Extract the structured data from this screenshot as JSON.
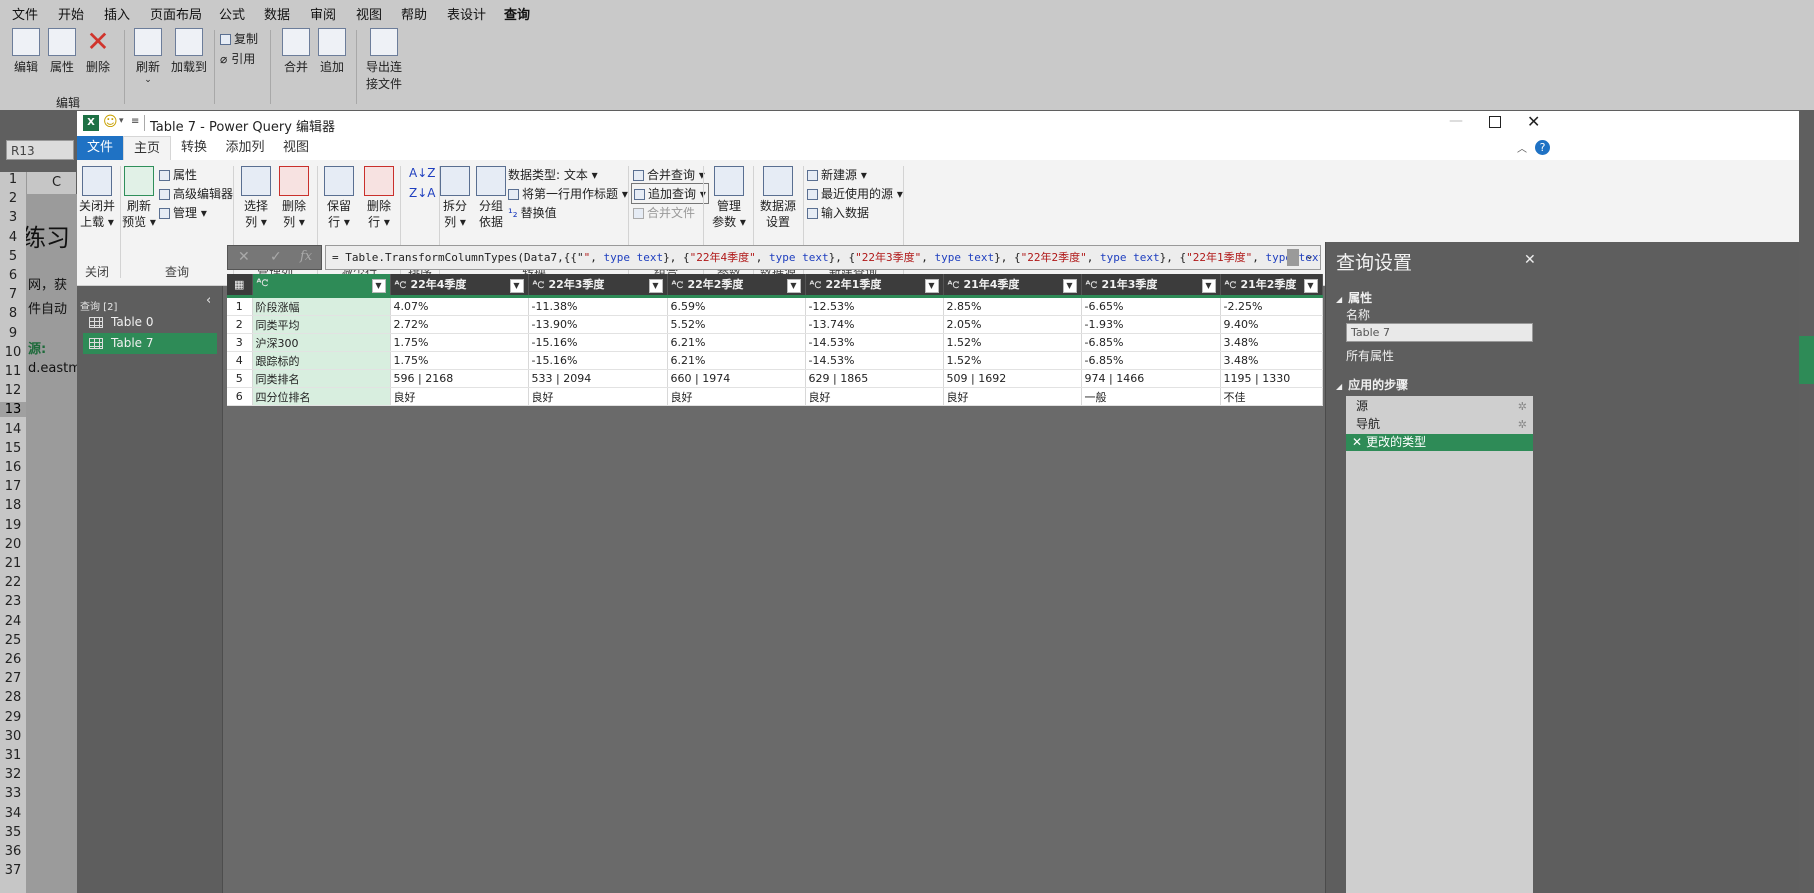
{
  "excel": {
    "menu": [
      "文件",
      "开始",
      "插入",
      "页面布局",
      "公式",
      "数据",
      "审阅",
      "视图",
      "帮助",
      "表设计",
      "查询"
    ],
    "ribbon": {
      "edit": "编辑",
      "properties": "属性",
      "delete": "删除",
      "refresh": "刷新",
      "load_to": "加载到",
      "copy": "复制",
      "reference": "引用",
      "merge": "合并",
      "append": "追加",
      "export_line1": "导出连",
      "export_line2": "接文件",
      "group_label": "编辑"
    },
    "name_box": "R13",
    "col_header": "C",
    "rows": [
      "1",
      "2",
      "3",
      "4",
      "5",
      "6",
      "7",
      "8",
      "9",
      "10",
      "11",
      "12",
      "13",
      "14",
      "15",
      "16",
      "17",
      "18",
      "19",
      "20",
      "21",
      "22",
      "23",
      "24",
      "25",
      "26",
      "27",
      "28",
      "29",
      "30",
      "31",
      "32",
      "33",
      "34",
      "35",
      "36",
      "37"
    ],
    "sheet_text": {
      "title": "练习",
      "line1": "网，获",
      "line2": "件自动",
      "source": "源:",
      "url": "d.eastm"
    }
  },
  "pq": {
    "window_title": "Table 7 - Power Query 编辑器",
    "tabs": [
      "文件",
      "主页",
      "转换",
      "添加列",
      "视图"
    ],
    "ribbon": {
      "close_load_1": "关闭并",
      "close_load_2": "上载",
      "refresh_1": "刷新",
      "refresh_2": "预览",
      "properties": "属性",
      "advanced_editor": "高级编辑器",
      "manage": "管理",
      "choose_cols_1": "选择",
      "choose_cols_2": "列",
      "remove_cols_1": "删除",
      "remove_cols_2": "列",
      "keep_rows_1": "保留",
      "keep_rows_2": "行",
      "remove_rows_1": "删除",
      "remove_rows_2": "行",
      "split_1": "拆分",
      "split_2": "列",
      "group_1": "分组",
      "group_2": "依据",
      "data_type": "数据类型: 文本",
      "first_row_header": "将第一行用作标题",
      "replace_values": "替换值",
      "merge_queries": "合并查询",
      "append_queries": "追加查询",
      "combine_files": "合并文件",
      "manage_params_1": "管理",
      "manage_params_2": "参数",
      "ds_settings_1": "数据源",
      "ds_settings_2": "设置",
      "new_source": "新建源",
      "recent_sources": "最近使用的源",
      "enter_data": "输入数据"
    },
    "groups": [
      "关闭",
      "查询",
      "管理列",
      "减少行",
      "排序",
      "转换",
      "组合",
      "参数",
      "数据源",
      "新建查询"
    ],
    "queries": {
      "header": "查询 [2]",
      "items": [
        "Table 0",
        "Table 7"
      ]
    },
    "formula": {
      "prefix": "= Table.TransformColumnTypes(Data7,{{\"",
      "parts": [
        {
          "s": "\"",
          "t": "type text"
        },
        {
          "s": "\"22年4季度\"",
          "t": "type text"
        },
        {
          "s": "\"22年3季度\"",
          "t": "type text"
        },
        {
          "s": "\"22年2季度\"",
          "t": "type text"
        },
        {
          "s": "\"22年1季度\"",
          "t": "type text"
        },
        {
          "s": "\"21年4季度\"",
          "t": ""
        }
      ]
    },
    "table": {
      "headers": [
        "",
        "22年4季度",
        "22年3季度",
        "22年2季度",
        "22年1季度",
        "21年4季度",
        "21年3季度",
        "21年2季度"
      ],
      "rows": [
        [
          "1",
          "阶段涨幅",
          "4.07%",
          "-11.38%",
          "6.59%",
          "-12.53%",
          "2.85%",
          "-6.65%",
          "-2.25%"
        ],
        [
          "2",
          "同类平均",
          "2.72%",
          "-13.90%",
          "5.52%",
          "-13.74%",
          "2.05%",
          "-1.93%",
          "9.40%"
        ],
        [
          "3",
          "沪深300",
          "1.75%",
          "-15.16%",
          "6.21%",
          "-14.53%",
          "1.52%",
          "-6.85%",
          "3.48%"
        ],
        [
          "4",
          "跟踪标的",
          "1.75%",
          "-15.16%",
          "6.21%",
          "-14.53%",
          "1.52%",
          "-6.85%",
          "3.48%"
        ],
        [
          "5",
          "同类排名",
          "596 | 2168",
          "533 | 2094",
          "660 | 1974",
          "629 | 1865",
          "509 | 1692",
          "974 | 1466",
          "1195 | 1330"
        ],
        [
          "6",
          "四分位排名",
          "良好",
          "良好",
          "良好",
          "良好",
          "良好",
          "一般",
          "不佳"
        ]
      ]
    },
    "settings": {
      "title": "查询设置",
      "properties": "属性",
      "name_label": "名称",
      "name_value": "Table 7",
      "all_props": "所有属性",
      "applied_steps": "应用的步骤",
      "steps": [
        "源",
        "导航",
        "更改的类型"
      ]
    }
  }
}
